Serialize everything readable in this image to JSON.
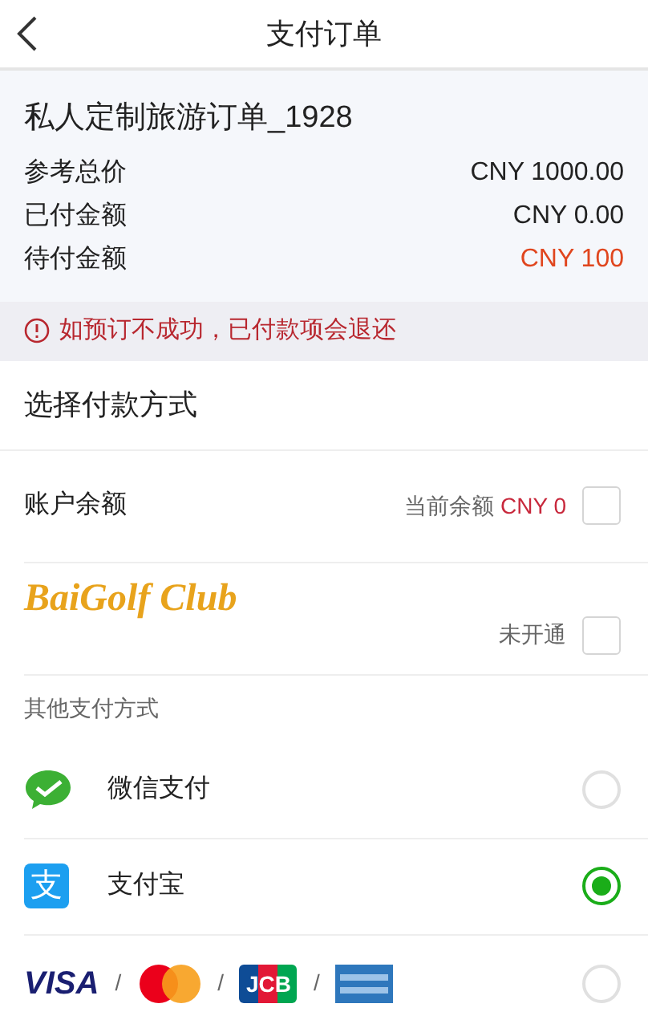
{
  "header": {
    "title": "支付订单"
  },
  "order": {
    "name": "私人定制旅游订单_1928",
    "rows": [
      {
        "label": "参考总价",
        "value": "CNY 1000.00",
        "highlight": false
      },
      {
        "label": "已付金额",
        "value": "CNY 0.00",
        "highlight": false
      },
      {
        "label": "待付金额",
        "value": "CNY 100",
        "highlight": true
      }
    ]
  },
  "notice": "如预订不成功，已付款项会退还",
  "section_title": "选择付款方式",
  "accounts": [
    {
      "kind": "balance",
      "label": "账户余额",
      "hint": "当前余额",
      "amount": "CNY 0",
      "checked": false
    },
    {
      "kind": "club",
      "label": "BaiGolf Club",
      "hint": "未开通",
      "checked": false
    }
  ],
  "other_title": "其他支付方式",
  "methods": [
    {
      "kind": "wechat",
      "label": "微信支付",
      "selected": false
    },
    {
      "kind": "alipay",
      "glyph": "支",
      "label": "支付宝",
      "selected": true
    },
    {
      "kind": "cards",
      "brands": [
        {
          "kind": "visa",
          "text": "VISA"
        },
        {
          "kind": "mastercard"
        },
        {
          "kind": "jcb",
          "text": "JCB"
        },
        {
          "kind": "amex"
        }
      ],
      "separator": "/",
      "selected": false
    }
  ]
}
